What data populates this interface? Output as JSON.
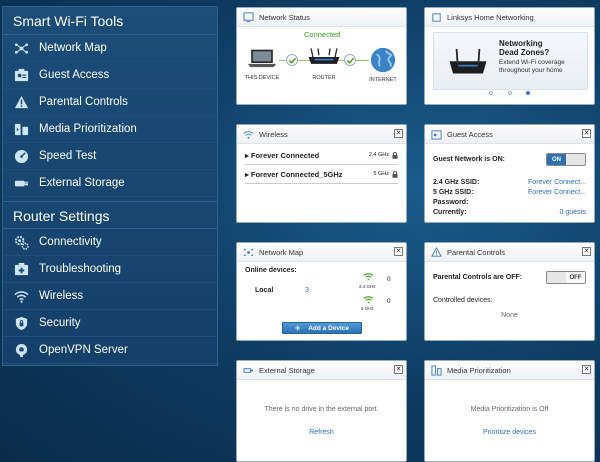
{
  "sidebar": {
    "section1": "Smart Wi-Fi Tools",
    "tools": [
      {
        "label": "Network Map",
        "icon": "network-map-icon"
      },
      {
        "label": "Guest Access",
        "icon": "guest-access-icon"
      },
      {
        "label": "Parental Controls",
        "icon": "warning-icon"
      },
      {
        "label": "Media Prioritization",
        "icon": "media-prioritization-icon"
      },
      {
        "label": "Speed Test",
        "icon": "speed-test-icon"
      },
      {
        "label": "External Storage",
        "icon": "usb-icon"
      }
    ],
    "section2": "Router Settings",
    "settings": [
      {
        "label": "Connectivity",
        "icon": "gear-icon"
      },
      {
        "label": "Troubleshooting",
        "icon": "troubleshooting-icon"
      },
      {
        "label": "Wireless",
        "icon": "wifi-icon"
      },
      {
        "label": "Security",
        "icon": "shield-icon"
      },
      {
        "label": "OpenVPN Server",
        "icon": "vpn-icon"
      }
    ]
  },
  "network_status": {
    "title": "Network Status",
    "connected": "Connected",
    "this_device": "THIS DEVICE",
    "router": "ROUTER",
    "internet": "INTERNET"
  },
  "linksys": {
    "title": "Linksys Home Networking",
    "ad_title_1": "Networking",
    "ad_title_2": "Dead Zones?",
    "ad_sub_1": "Extend Wi-Fi coverage",
    "ad_sub_2": "throughout your home"
  },
  "wireless": {
    "title": "Wireless",
    "networks": [
      {
        "name": "Forever Connected",
        "band": "2.4 GHz"
      },
      {
        "name": "Forever Connected_5GHz",
        "band": "5 GHz"
      }
    ]
  },
  "guest": {
    "title": "Guest Access",
    "status_label": "Guest Network is ON:",
    "toggle_on": "ON",
    "ssid24_label": "2.4 GHz SSID:",
    "ssid24_value": "Forever Connect...",
    "ssid5_label": "5 GHz SSID:",
    "ssid5_value": "Forever Connect...",
    "password_label": "Password:",
    "currently_label": "Currently:",
    "currently_value": "0 guests"
  },
  "network_map": {
    "title": "Network Map",
    "online_label": "Online devices:",
    "local_label": "Local",
    "local_count": "3",
    "band24_count": "0",
    "band24_label": "2.4 GHz",
    "band5_count": "0",
    "band5_label": "5 GHz",
    "add_label": "Add a Device"
  },
  "parental": {
    "title": "Parental Controls",
    "status_label": "Parental Controls are OFF:",
    "toggle_off": "OFF",
    "controlled_label": "Controlled devices:",
    "none": "None"
  },
  "storage": {
    "title": "External Storage",
    "message": "There is no drive in the external port.",
    "refresh": "Refresh"
  },
  "media": {
    "title": "Media Prioritization",
    "message": "Media Prioritization is Off",
    "link": "Prioritize devices"
  },
  "colors": {
    "accent": "#2d6fb5",
    "success": "#3c9a1c",
    "sidebar": "#1b4d78"
  }
}
